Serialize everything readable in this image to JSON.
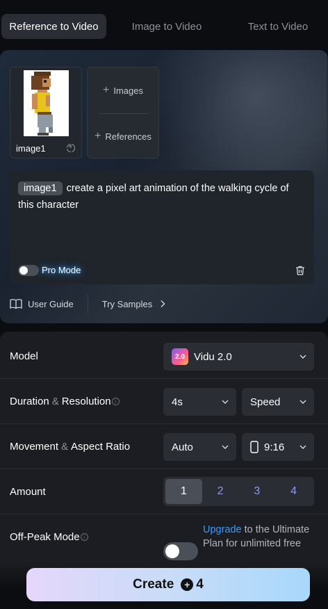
{
  "tabs": [
    {
      "label": "Reference to Video",
      "active": true
    },
    {
      "label": "Image to Video",
      "active": false
    },
    {
      "label": "Text to Video",
      "active": false
    }
  ],
  "reference": {
    "image_label": "image1",
    "add_images": "Images",
    "add_references": "References"
  },
  "prompt": {
    "chip": "image1",
    "text": "create a pixel art animation of the walking cycle of this character",
    "pro_mode_label": "Pro Mode",
    "pro_mode_on": false
  },
  "links": {
    "user_guide": "User Guide",
    "try_samples": "Try Samples"
  },
  "settings": {
    "model": {
      "label": "Model",
      "value": "Vidu 2.0",
      "logo_text": "2.0"
    },
    "duration": {
      "label_a": "Duration",
      "amp": "&",
      "label_b": "Resolution",
      "value": "4s",
      "resolution": "Speed"
    },
    "movement": {
      "label_a": "Movement",
      "amp": "&",
      "label_b": "Aspect Ratio",
      "value": "Auto",
      "aspect": "9:16"
    },
    "amount": {
      "label": "Amount",
      "options": [
        "1",
        "2",
        "3",
        "4"
      ],
      "selected": "1"
    },
    "offpeak": {
      "label": "Off-Peak Mode",
      "on": false,
      "upgrade_link": "Upgrade",
      "upgrade_text": " to the Ultimate Plan for unlimited free"
    }
  },
  "create": {
    "label": "Create",
    "credits": "4"
  },
  "colors": {
    "accent": "#3a9bff",
    "amount_text": "#8e97f0",
    "create_gradient_start": "#e4d7fb",
    "create_gradient_end": "#a7d8fb"
  }
}
